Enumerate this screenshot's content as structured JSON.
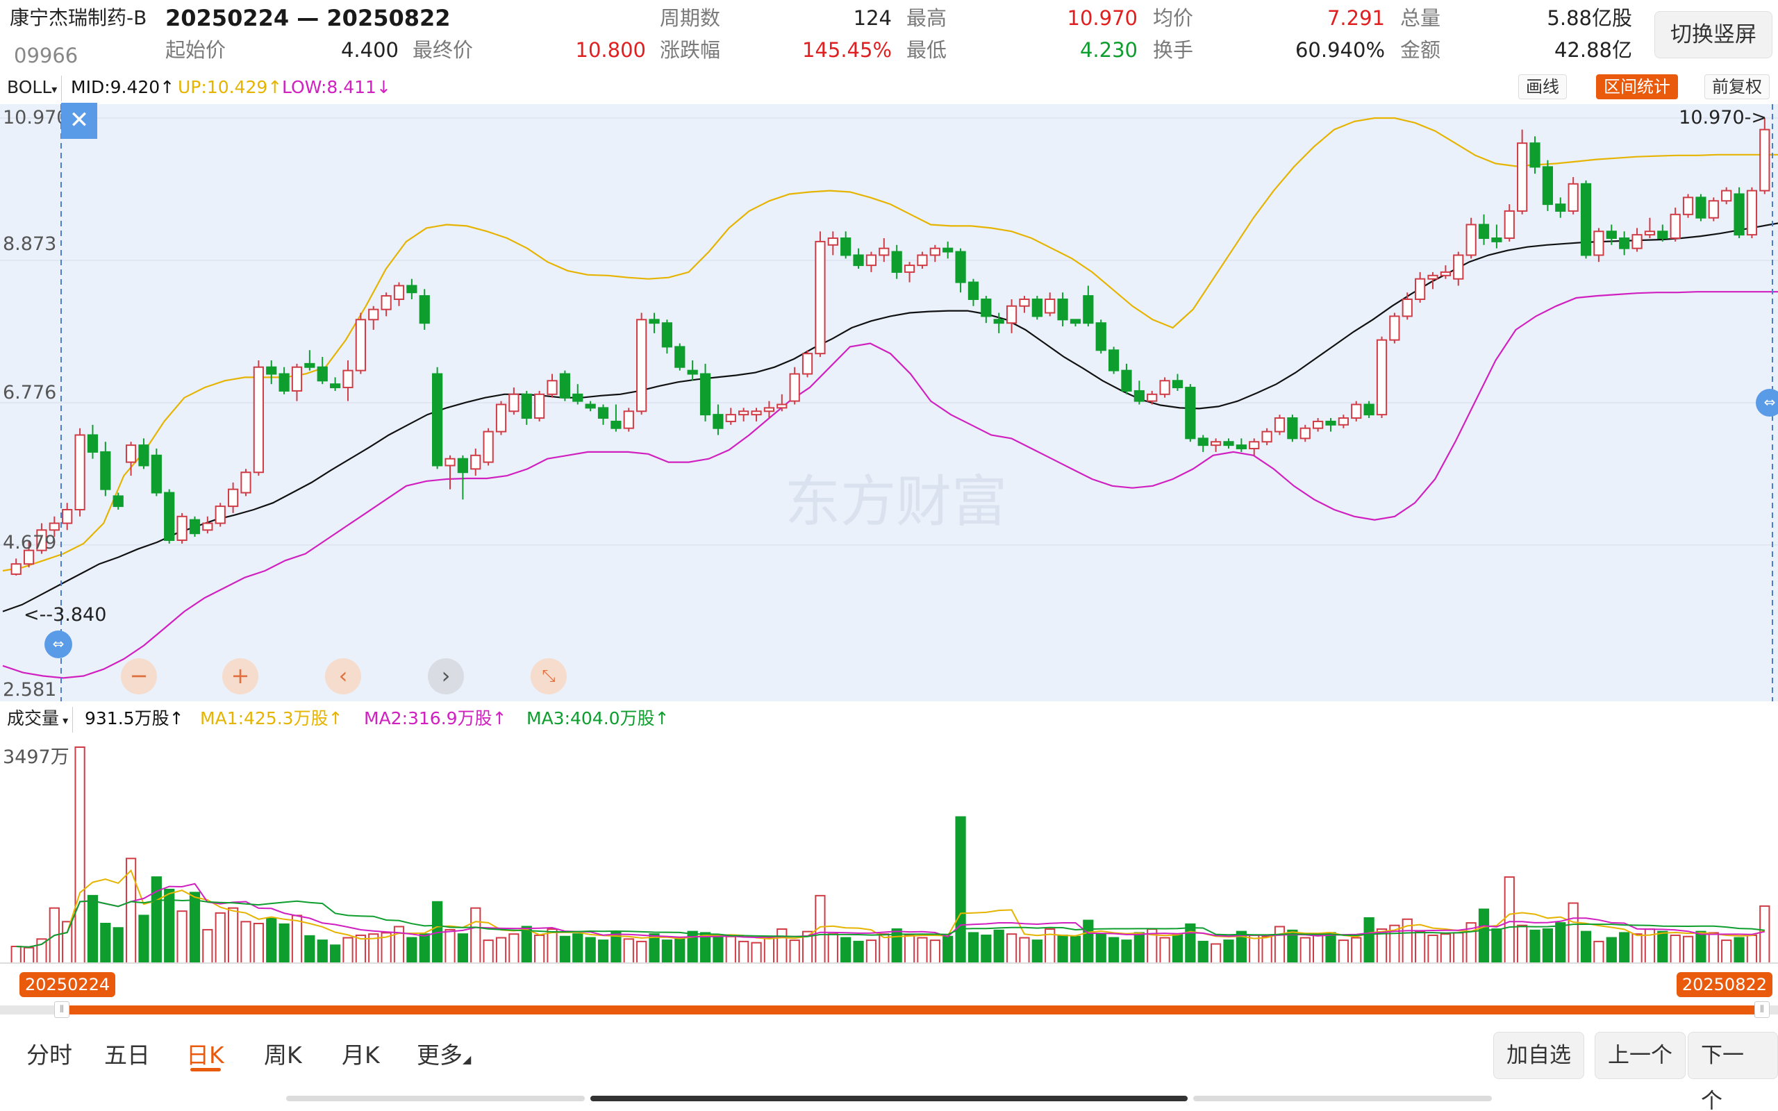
{
  "header": {
    "stock_name": "康宁杰瑞制药-B",
    "stock_code": "09966",
    "date_range": "20250224 — 20250822",
    "stats": [
      {
        "label": "起始价",
        "value": "4.400",
        "cls": "dark"
      },
      {
        "label": "最终价",
        "value": "10.800",
        "cls": "red"
      },
      {
        "label": "周期数",
        "value": "124",
        "cls": "dark"
      },
      {
        "label": "涨跌幅",
        "value": "145.45%",
        "cls": "red"
      },
      {
        "label": "最高",
        "value": "10.970",
        "cls": "red"
      },
      {
        "label": "最低",
        "value": "4.230",
        "cls": "grn"
      },
      {
        "label": "均价",
        "value": "7.291",
        "cls": "red"
      },
      {
        "label": "换手",
        "value": "60.940%",
        "cls": "dark"
      },
      {
        "label": "总量",
        "value": "5.88亿股",
        "cls": "dark"
      },
      {
        "label": "金额",
        "value": "42.88亿",
        "cls": "dark"
      }
    ],
    "switch_button": "切换竖屏"
  },
  "boll_bar": {
    "indicator": "BOLL",
    "mid": "MID:9.420",
    "up": "UP:10.429",
    "low": "LOW:8.411",
    "arrow_up": "↑",
    "arrow_down": "↓",
    "tools": {
      "draw": "画线",
      "range": "区间统计",
      "adjust": "前复权"
    },
    "colors": {
      "mid": "#111111",
      "up": "#e6b400",
      "low": "#d020c0"
    }
  },
  "price_axis": {
    "labels": [
      "10.970",
      "8.873",
      "6.776",
      "4.679",
      "2.581"
    ],
    "max_marker": "10.970->",
    "min_marker": "<--3.840"
  },
  "volume_bar": {
    "indicator": "成交量",
    "value": "931.5万股",
    "ma1": "MA1:425.3万股",
    "ma2": "MA2:316.9万股",
    "ma3": "MA3:404.0万股",
    "arrow": "↑",
    "axis_max": "3497万",
    "colors": {
      "ma1": "#e6b400",
      "ma2": "#d020c0",
      "ma3": "#0e9e2e"
    }
  },
  "range": {
    "start": "20250224",
    "end": "20250822"
  },
  "tabs": [
    "分时",
    "五日",
    "日K",
    "周K",
    "月K",
    "更多"
  ],
  "active_tab": "日K",
  "nav": {
    "add": "加自选",
    "prev": "上一个",
    "next": "下一个"
  },
  "watermark": "东方财富",
  "chart_data": {
    "type": "candlestick",
    "title": "",
    "price_ylim": [
      2.581,
      10.97
    ],
    "volume_ylim": [
      0,
      3497
    ],
    "volume_unit": "万股",
    "colors": {
      "up": "#d03c46",
      "down": "#0e9e2e"
    },
    "candles": [
      [
        4.25,
        4.48,
        4.23,
        4.4
      ],
      [
        4.4,
        4.75,
        4.35,
        4.6
      ],
      [
        4.6,
        5.0,
        4.55,
        4.9
      ],
      [
        4.9,
        5.1,
        4.8,
        5.0
      ],
      [
        5.0,
        5.3,
        4.9,
        5.2
      ],
      [
        5.2,
        6.4,
        5.1,
        6.3
      ],
      [
        6.3,
        6.45,
        5.95,
        6.05
      ],
      [
        6.05,
        6.2,
        5.4,
        5.5
      ],
      [
        5.4,
        5.45,
        5.2,
        5.25
      ],
      [
        5.9,
        6.2,
        5.7,
        6.15
      ],
      [
        6.15,
        6.25,
        5.8,
        5.85
      ],
      [
        6.0,
        6.1,
        5.4,
        5.45
      ],
      [
        5.45,
        5.5,
        4.7,
        4.75
      ],
      [
        4.75,
        5.15,
        4.7,
        5.1
      ],
      [
        5.05,
        5.1,
        4.8,
        4.85
      ],
      [
        4.9,
        5.1,
        4.85,
        5.0
      ],
      [
        5.0,
        5.3,
        4.95,
        5.25
      ],
      [
        5.25,
        5.6,
        5.15,
        5.5
      ],
      [
        5.45,
        5.8,
        5.4,
        5.75
      ],
      [
        5.75,
        7.4,
        5.7,
        7.3
      ],
      [
        7.3,
        7.4,
        7.05,
        7.2
      ],
      [
        7.2,
        7.3,
        6.9,
        6.95
      ],
      [
        6.95,
        7.35,
        6.8,
        7.3
      ],
      [
        7.35,
        7.55,
        7.25,
        7.3
      ],
      [
        7.3,
        7.45,
        7.05,
        7.1
      ],
      [
        7.05,
        7.15,
        6.95,
        7.0
      ],
      [
        7.0,
        7.4,
        6.8,
        7.25
      ],
      [
        7.25,
        8.1,
        7.2,
        8.0
      ],
      [
        8.0,
        8.2,
        7.85,
        8.15
      ],
      [
        8.15,
        8.4,
        8.05,
        8.35
      ],
      [
        8.3,
        8.55,
        8.2,
        8.5
      ],
      [
        8.5,
        8.6,
        8.3,
        8.4
      ],
      [
        8.35,
        8.45,
        7.85,
        7.95
      ],
      [
        7.2,
        7.3,
        5.8,
        5.85
      ],
      [
        5.85,
        6.0,
        5.5,
        5.95
      ],
      [
        5.95,
        6.0,
        5.35,
        5.75
      ],
      [
        5.8,
        6.1,
        5.7,
        6.0
      ],
      [
        5.9,
        6.4,
        5.85,
        6.35
      ],
      [
        6.35,
        6.8,
        6.3,
        6.75
      ],
      [
        6.65,
        7.0,
        6.6,
        6.9
      ],
      [
        6.9,
        6.95,
        6.45,
        6.55
      ],
      [
        6.55,
        6.95,
        6.5,
        6.9
      ],
      [
        6.9,
        7.2,
        6.85,
        7.1
      ],
      [
        7.2,
        7.25,
        6.8,
        6.85
      ],
      [
        6.9,
        7.05,
        6.75,
        6.8
      ],
      [
        6.75,
        6.8,
        6.65,
        6.7
      ],
      [
        6.7,
        6.75,
        6.45,
        6.55
      ],
      [
        6.5,
        6.75,
        6.35,
        6.4
      ],
      [
        6.4,
        6.7,
        6.35,
        6.65
      ],
      [
        6.65,
        8.1,
        6.6,
        8.0
      ],
      [
        8.0,
        8.1,
        7.8,
        7.95
      ],
      [
        7.95,
        8.0,
        7.5,
        7.6
      ],
      [
        7.6,
        7.65,
        7.25,
        7.3
      ],
      [
        7.25,
        7.4,
        7.1,
        7.2
      ],
      [
        7.2,
        7.35,
        6.5,
        6.6
      ],
      [
        6.6,
        6.75,
        6.3,
        6.4
      ],
      [
        6.5,
        6.7,
        6.45,
        6.6
      ],
      [
        6.6,
        6.7,
        6.5,
        6.65
      ],
      [
        6.6,
        6.7,
        6.5,
        6.65
      ],
      [
        6.65,
        6.8,
        6.55,
        6.7
      ],
      [
        6.7,
        6.9,
        6.65,
        6.75
      ],
      [
        6.8,
        7.3,
        6.75,
        7.2
      ],
      [
        7.2,
        7.55,
        7.15,
        7.5
      ],
      [
        7.5,
        9.3,
        7.45,
        9.15
      ],
      [
        9.1,
        9.3,
        8.95,
        9.2
      ],
      [
        9.2,
        9.3,
        8.9,
        8.95
      ],
      [
        8.95,
        9.05,
        8.75,
        8.8
      ],
      [
        8.8,
        9.0,
        8.7,
        8.95
      ],
      [
        8.95,
        9.2,
        8.85,
        9.05
      ],
      [
        9.0,
        9.1,
        8.6,
        8.7
      ],
      [
        8.7,
        8.85,
        8.55,
        8.8
      ],
      [
        8.8,
        9.0,
        8.75,
        8.95
      ],
      [
        8.95,
        9.1,
        8.85,
        9.05
      ],
      [
        9.05,
        9.15,
        8.9,
        9.0
      ],
      [
        9.0,
        9.05,
        8.4,
        8.55
      ],
      [
        8.55,
        8.6,
        8.2,
        8.3
      ],
      [
        8.3,
        8.35,
        7.95,
        8.05
      ],
      [
        8.0,
        8.1,
        7.8,
        7.95
      ],
      [
        7.95,
        8.3,
        7.8,
        8.2
      ],
      [
        8.2,
        8.35,
        8.1,
        8.3
      ],
      [
        8.3,
        8.35,
        8.0,
        8.05
      ],
      [
        8.1,
        8.4,
        8.05,
        8.3
      ],
      [
        8.3,
        8.4,
        7.9,
        8.0
      ],
      [
        8.0,
        8.0,
        7.9,
        7.95
      ],
      [
        8.35,
        8.5,
        7.9,
        7.95
      ],
      [
        7.95,
        8.0,
        7.5,
        7.55
      ],
      [
        7.55,
        7.6,
        7.2,
        7.25
      ],
      [
        7.25,
        7.35,
        6.9,
        6.95
      ],
      [
        6.95,
        7.1,
        6.75,
        6.8
      ],
      [
        6.8,
        6.95,
        6.75,
        6.9
      ],
      [
        6.9,
        7.15,
        6.85,
        7.1
      ],
      [
        7.1,
        7.2,
        6.95,
        7.0
      ],
      [
        7.0,
        7.05,
        6.2,
        6.25
      ],
      [
        6.25,
        6.3,
        6.05,
        6.15
      ],
      [
        6.15,
        6.25,
        6.05,
        6.2
      ],
      [
        6.2,
        6.25,
        6.1,
        6.15
      ],
      [
        6.15,
        6.25,
        6.05,
        6.1
      ],
      [
        6.1,
        6.25,
        6.0,
        6.2
      ],
      [
        6.2,
        6.4,
        6.15,
        6.35
      ],
      [
        6.35,
        6.6,
        6.3,
        6.55
      ],
      [
        6.55,
        6.6,
        6.2,
        6.25
      ],
      [
        6.25,
        6.45,
        6.2,
        6.4
      ],
      [
        6.4,
        6.55,
        6.35,
        6.5
      ],
      [
        6.5,
        6.55,
        6.35,
        6.45
      ],
      [
        6.45,
        6.6,
        6.4,
        6.55
      ],
      [
        6.55,
        6.8,
        6.5,
        6.75
      ],
      [
        6.75,
        6.8,
        6.55,
        6.6
      ],
      [
        6.6,
        7.75,
        6.55,
        7.7
      ],
      [
        7.7,
        8.1,
        7.65,
        8.05
      ],
      [
        8.05,
        8.4,
        8.0,
        8.3
      ],
      [
        8.3,
        8.7,
        8.25,
        8.6
      ],
      [
        8.6,
        8.7,
        8.45,
        8.65
      ],
      [
        8.65,
        8.8,
        8.6,
        8.7
      ],
      [
        8.6,
        9.0,
        8.5,
        8.95
      ],
      [
        8.95,
        9.5,
        8.9,
        9.4
      ],
      [
        9.4,
        9.55,
        9.1,
        9.2
      ],
      [
        9.2,
        9.4,
        9.05,
        9.15
      ],
      [
        9.2,
        9.7,
        9.15,
        9.6
      ],
      [
        9.6,
        10.8,
        9.55,
        10.6
      ],
      [
        10.6,
        10.7,
        10.15,
        10.25
      ],
      [
        10.25,
        10.35,
        9.6,
        9.7
      ],
      [
        9.7,
        9.8,
        9.5,
        9.6
      ],
      [
        9.6,
        10.1,
        9.55,
        10.0
      ],
      [
        10.0,
        10.05,
        8.9,
        8.95
      ],
      [
        8.95,
        9.35,
        8.85,
        9.3
      ],
      [
        9.3,
        9.4,
        9.1,
        9.2
      ],
      [
        9.2,
        9.3,
        8.95,
        9.05
      ],
      [
        9.05,
        9.35,
        9.0,
        9.25
      ],
      [
        9.25,
        9.5,
        9.2,
        9.3
      ],
      [
        9.3,
        9.4,
        9.15,
        9.2
      ],
      [
        9.2,
        9.65,
        9.15,
        9.55
      ],
      [
        9.55,
        9.85,
        9.5,
        9.8
      ],
      [
        9.8,
        9.85,
        9.45,
        9.5
      ],
      [
        9.5,
        9.8,
        9.45,
        9.75
      ],
      [
        9.75,
        9.95,
        9.7,
        9.9
      ],
      [
        9.85,
        9.95,
        9.2,
        9.25
      ],
      [
        9.25,
        9.95,
        9.2,
        9.9
      ],
      [
        9.9,
        10.97,
        9.85,
        10.8
      ]
    ],
    "volume": [
      280,
      260,
      400,
      900,
      680,
      3497,
      1100,
      650,
      580,
      1700,
      780,
      1400,
      1200,
      850,
      1150,
      550,
      820,
      900,
      680,
      650,
      730,
      640,
      780,
      450,
      380,
      300,
      420,
      460,
      480,
      500,
      600,
      420,
      480,
      1000,
      550,
      480,
      900,
      380,
      420,
      480,
      600,
      460,
      560,
      440,
      480,
      420,
      380,
      520,
      400,
      360,
      480,
      380,
      420,
      520,
      500,
      460,
      440,
      360,
      340,
      420,
      560,
      380,
      520,
      1100,
      480,
      420,
      360,
      380,
      480,
      560,
      460,
      420,
      380,
      440,
      2370,
      500,
      460,
      540,
      480,
      420,
      380,
      560,
      460,
      440,
      700,
      480,
      420,
      380,
      500,
      560,
      420,
      480,
      640,
      360,
      320,
      380,
      520,
      460,
      440,
      600,
      540,
      420,
      460,
      500,
      380,
      420,
      740,
      560,
      620,
      720,
      520,
      460,
      480,
      500,
      660,
      880,
      560,
      1400,
      620,
      540,
      560,
      660,
      980,
      520,
      360,
      420,
      500,
      480,
      560,
      520,
      460,
      440,
      520,
      500,
      380,
      420,
      460,
      931.5
    ],
    "boll_mid": [
      3.7,
      3.8,
      3.95,
      4.1,
      4.25,
      4.4,
      4.5,
      4.62,
      4.72,
      4.85,
      4.95,
      5.05,
      5.12,
      5.2,
      5.3,
      5.45,
      5.6,
      5.78,
      5.95,
      6.12,
      6.3,
      6.45,
      6.6,
      6.7,
      6.78,
      6.85,
      6.9,
      6.9,
      6.88,
      6.85,
      6.85,
      6.88,
      6.9,
      6.95,
      7.02,
      7.08,
      7.12,
      7.15,
      7.18,
      7.22,
      7.3,
      7.42,
      7.58,
      7.72,
      7.88,
      7.98,
      8.05,
      8.1,
      8.12,
      8.13,
      8.13,
      8.08,
      8.0,
      7.85,
      7.65,
      7.45,
      7.28,
      7.1,
      6.95,
      6.82,
      6.74,
      6.7,
      6.69,
      6.72,
      6.8,
      6.92,
      7.05,
      7.22,
      7.42,
      7.62,
      7.82,
      8.0,
      8.2,
      8.38,
      8.55,
      8.7,
      8.85,
      8.95,
      9.02,
      9.07,
      9.1,
      9.12,
      9.14,
      9.15,
      9.16,
      9.17,
      9.18,
      9.2,
      9.23,
      9.27,
      9.32,
      9.37,
      9.42
    ],
    "boll_up": [
      4.3,
      4.35,
      4.45,
      4.55,
      4.7,
      5.0,
      5.7,
      6.05,
      6.5,
      6.85,
      7.0,
      7.1,
      7.15,
      7.15,
      7.15,
      7.2,
      7.3,
      7.7,
      8.2,
      8.75,
      9.15,
      9.35,
      9.4,
      9.38,
      9.3,
      9.2,
      9.05,
      8.85,
      8.72,
      8.66,
      8.65,
      8.62,
      8.6,
      8.62,
      8.7,
      9.0,
      9.35,
      9.6,
      9.75,
      9.85,
      9.88,
      9.9,
      9.88,
      9.8,
      9.7,
      9.55,
      9.4,
      9.38,
      9.38,
      9.35,
      9.3,
      9.2,
      9.05,
      8.9,
      8.7,
      8.45,
      8.2,
      8.0,
      7.88,
      8.15,
      8.6,
      9.05,
      9.5,
      9.9,
      10.25,
      10.55,
      10.8,
      10.92,
      10.97,
      10.97,
      10.9,
      10.78,
      10.6,
      10.42,
      10.3,
      10.26,
      10.28,
      10.3,
      10.33,
      10.36,
      10.38,
      10.4,
      10.41,
      10.42,
      10.42,
      10.43,
      10.43,
      10.43,
      10.43
    ],
    "boll_low": [
      2.9,
      2.8,
      2.75,
      2.72,
      2.75,
      2.85,
      3.0,
      3.2,
      3.45,
      3.7,
      3.9,
      4.05,
      4.2,
      4.3,
      4.45,
      4.55,
      4.75,
      4.95,
      5.15,
      5.35,
      5.55,
      5.62,
      5.65,
      5.66,
      5.66,
      5.7,
      5.8,
      5.95,
      6.0,
      6.05,
      6.05,
      6.05,
      6.02,
      5.9,
      5.9,
      5.95,
      6.08,
      6.3,
      6.55,
      6.8,
      7.0,
      7.3,
      7.6,
      7.65,
      7.5,
      7.2,
      6.8,
      6.6,
      6.45,
      6.3,
      6.25,
      6.1,
      5.95,
      5.8,
      5.65,
      5.55,
      5.52,
      5.55,
      5.65,
      5.8,
      6.0,
      6.05,
      6.0,
      5.8,
      5.55,
      5.35,
      5.2,
      5.1,
      5.05,
      5.1,
      5.3,
      5.65,
      6.2,
      6.8,
      7.4,
      7.85,
      8.05,
      8.2,
      8.32,
      8.35,
      8.37,
      8.39,
      8.4,
      8.4,
      8.41,
      8.41,
      8.41,
      8.41,
      8.41
    ]
  }
}
